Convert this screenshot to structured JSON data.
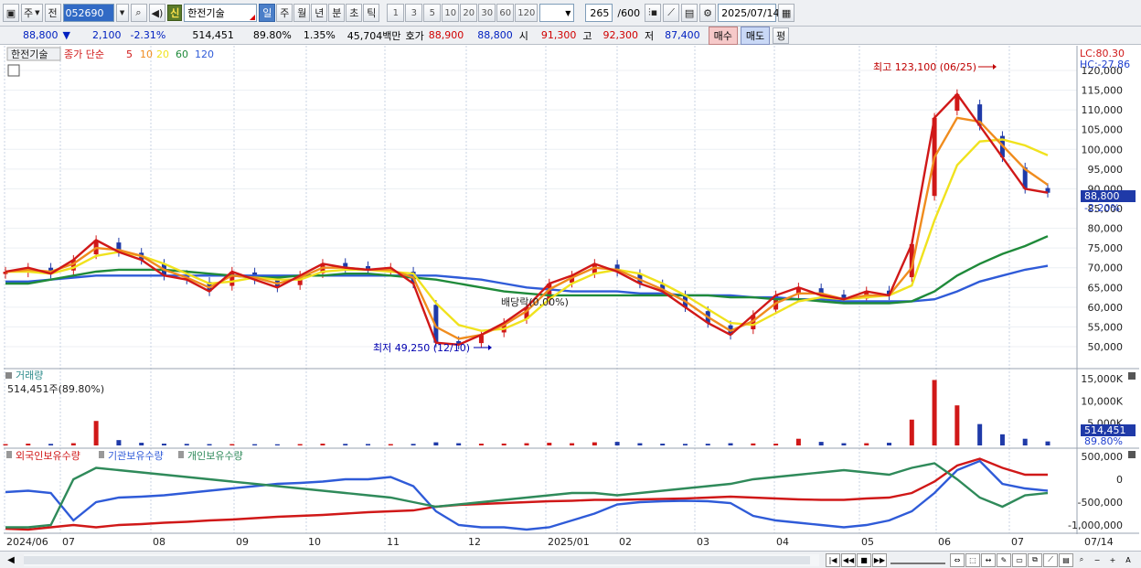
{
  "toolbar": {
    "type_select": "주",
    "prev_label": "전",
    "code": "052690",
    "sin_badge": "신",
    "stock_name": "한전기술",
    "period_tabs": [
      "일",
      "주",
      "월",
      "년",
      "분",
      "초",
      "틱"
    ],
    "active_period": "일",
    "interval_options": [
      "1",
      "3",
      "5",
      "10",
      "20",
      "30",
      "60",
      "120"
    ],
    "count": "265",
    "count_max": "/600",
    "date": "2025/07/14"
  },
  "quote": {
    "price": "88,800",
    "direction": "▼",
    "change": "2,100",
    "change_pct": "-2.31%",
    "volume": "514,451",
    "volume_ratio": "89.80%",
    "turnover": "1.35%",
    "amount": "45,704백만",
    "bid_label": "호가",
    "bid_price": "88,900",
    "ask_price": "88,800",
    "open_label": "시",
    "open": "91,300",
    "high_label": "고",
    "high": "92,300",
    "low_label": "저",
    "low": "87,400",
    "buy_label": "매수",
    "sell_label": "매도",
    "flat_label": "평"
  },
  "price_panel": {
    "legend_name": "한전기술",
    "legend_ma_label": "종가 단순",
    "ma_periods": [
      "5",
      "10",
      "20",
      "60",
      "120"
    ],
    "ma_colors": [
      "#d01818",
      "#f08c1e",
      "#f0e21e",
      "#1f8a3a",
      "#2f5bd8"
    ],
    "lc_label": "LC:80.30",
    "hc_label": "HC:-27.86",
    "max_annotation": "최고 123,100 (06/25)",
    "min_annotation": "최저 49,250 (12/10)",
    "dividend_annotation": "배당락(0.00%)",
    "current_price_tag": "88,800",
    "current_change_tag": "-2.20%"
  },
  "volume_panel": {
    "title": "거래량",
    "value_label": "514,451주(89.80%)",
    "current_tag": "514,451",
    "current_ratio": "89.80%"
  },
  "holdings_panel": {
    "series_labels": [
      "외국인보유수량",
      "기관보유수량",
      "개인보유수량"
    ],
    "series_colors": [
      "#d01818",
      "#2f5bd8",
      "#2f8a5a"
    ]
  },
  "chart_data": {
    "type": "line",
    "price_axis": [
      "120,000",
      "115,000",
      "110,000",
      "105,000",
      "100,000",
      "95,000",
      "90,000",
      "85,000",
      "80,000",
      "75,000",
      "70,000",
      "65,000",
      "60,000",
      "55,000",
      "50,000"
    ],
    "volume_axis": [
      "15,000K",
      "10,000K",
      "5,000K"
    ],
    "holdings_axis": [
      "500,000",
      "0",
      "-500,000",
      "-1,000,000"
    ],
    "x_labels": [
      "2024/06",
      "07",
      "08",
      "09",
      "10",
      "11",
      "12",
      "2025/01",
      "02",
      "03",
      "04",
      "05",
      "06",
      "07"
    ],
    "x_current": "07/14",
    "ma5": [
      69000,
      70000,
      68500,
      72000,
      77000,
      74000,
      72000,
      68000,
      67000,
      64000,
      69000,
      67000,
      65000,
      68000,
      71000,
      70000,
      69500,
      70000,
      66000,
      51000,
      50500,
      53000,
      56000,
      60000,
      66000,
      68000,
      71000,
      69000,
      66000,
      64000,
      60000,
      56000,
      53000,
      58000,
      63000,
      65000,
      63000,
      62000,
      64000,
      63000,
      76000,
      108000,
      114000,
      106000,
      98000,
      90000,
      89000
    ],
    "ma10": [
      69000,
      69500,
      69000,
      71000,
      75000,
      74500,
      73000,
      69500,
      67500,
      65000,
      68000,
      67500,
      66000,
      67500,
      70000,
      70000,
      69500,
      69500,
      67500,
      55000,
      52000,
      53000,
      55500,
      59000,
      64500,
      67500,
      70000,
      69500,
      67000,
      64500,
      61500,
      57500,
      54000,
      56500,
      61000,
      63500,
      63500,
      62000,
      63000,
      63000,
      70000,
      98000,
      108000,
      107000,
      101000,
      95000,
      91000
    ],
    "ma20": [
      69000,
      69000,
      68500,
      70000,
      73000,
      74000,
      73000,
      71000,
      68500,
      66000,
      66500,
      67500,
      67000,
      67000,
      69000,
      69500,
      69500,
      69000,
      68500,
      61000,
      55500,
      54000,
      54500,
      57000,
      62000,
      66000,
      68500,
      69500,
      68500,
      66000,
      63000,
      59500,
      56000,
      55500,
      58500,
      61500,
      62500,
      62000,
      62500,
      63000,
      65500,
      82000,
      96000,
      102000,
      102500,
      101000,
      98500
    ],
    "ma60": [
      66000,
      66000,
      67000,
      68000,
      69000,
      69500,
      69500,
      69500,
      69000,
      68500,
      68000,
      67500,
      67500,
      68000,
      68000,
      68500,
      68500,
      68000,
      67500,
      67000,
      66000,
      65000,
      64000,
      63500,
      63000,
      63000,
      63000,
      63000,
      63000,
      63000,
      63000,
      63000,
      62500,
      62500,
      62000,
      62000,
      61500,
      61000,
      61000,
      61000,
      61500,
      64000,
      68000,
      71000,
      73500,
      75500,
      78000
    ],
    "ma120": [
      66500,
      66500,
      67000,
      67500,
      68000,
      68000,
      68000,
      68000,
      68000,
      68000,
      68000,
      68000,
      68000,
      68000,
      68000,
      68000,
      68000,
      68000,
      68000,
      68000,
      67500,
      67000,
      66000,
      65000,
      64500,
      64000,
      64000,
      64000,
      63500,
      63500,
      63000,
      63000,
      63000,
      62500,
      62500,
      62000,
      62000,
      61500,
      61500,
      61500,
      61500,
      62000,
      64000,
      66500,
      68000,
      69500,
      70500
    ],
    "volume_k": [
      300,
      400,
      350,
      500,
      5500,
      1200,
      600,
      400,
      350,
      300,
      300,
      280,
      260,
      300,
      400,
      350,
      320,
      300,
      350,
      700,
      500,
      400,
      420,
      500,
      600,
      500,
      700,
      800,
      500,
      400,
      350,
      380,
      500,
      450,
      400,
      1500,
      800,
      500,
      500,
      600,
      5800,
      14700,
      9000,
      4800,
      2500,
      1500,
      900
    ],
    "foreign_k": [
      -1080,
      -1100,
      -1050,
      -1000,
      -1050,
      -1000,
      -980,
      -950,
      -930,
      -900,
      -880,
      -850,
      -820,
      -800,
      -780,
      -750,
      -720,
      -700,
      -680,
      -600,
      -560,
      -540,
      -520,
      -500,
      -480,
      -470,
      -450,
      -450,
      -440,
      -430,
      -420,
      -400,
      -380,
      -400,
      -420,
      -440,
      -450,
      -450,
      -420,
      -400,
      -300,
      -50,
      300,
      450,
      250,
      100,
      100
    ],
    "institution_k": [
      -280,
      -250,
      -300,
      -900,
      -500,
      -400,
      -380,
      -350,
      -300,
      -250,
      -200,
      -150,
      -100,
      -80,
      -50,
      0,
      0,
      50,
      -150,
      -700,
      -1000,
      -1050,
      -1050,
      -1100,
      -1050,
      -900,
      -750,
      -550,
      -500,
      -480,
      -470,
      -480,
      -520,
      -800,
      -900,
      -950,
      -1000,
      -1050,
      -1000,
      -900,
      -700,
      -300,
      200,
      400,
      -100,
      -200,
      -250
    ],
    "individual_k": [
      -1050,
      -1050,
      -1000,
      0,
      250,
      200,
      150,
      100,
      50,
      0,
      -50,
      -100,
      -150,
      -200,
      -250,
      -300,
      -350,
      -400,
      -500,
      -600,
      -550,
      -500,
      -450,
      -400,
      -350,
      -300,
      -300,
      -350,
      -300,
      -250,
      -200,
      -150,
      -100,
      0,
      50,
      100,
      150,
      200,
      150,
      100,
      250,
      350,
      0,
      -400,
      -600,
      -350,
      -300
    ]
  }
}
